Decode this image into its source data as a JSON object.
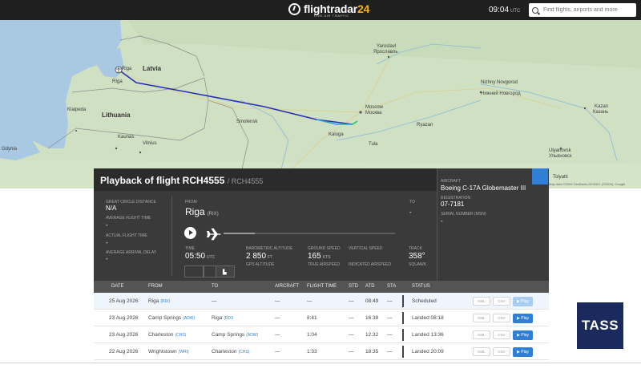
{
  "header": {
    "logo_main": "flightradar",
    "logo_num": "24",
    "logo_sub": "LIVE AIR TRAFFIC",
    "time": "09:04",
    "time_unit": "UTC",
    "search_placeholder": "Find flights, airports and more"
  },
  "map": {
    "labels": {
      "latvia": "Latvia",
      "lithuania": "Lithuania",
      "riga": "Riga",
      "riga_cyr": "Rīga",
      "moscow": "Moscow",
      "moscow_cyr": "Москва",
      "yaroslavl": "Yaroslavl",
      "yaroslavl_cyr": "Ярославль",
      "nizhny": "Nizhny Novgorod",
      "nizhny_cyr": "Нижний Новгород",
      "kazan": "Kazan",
      "kazan_cyr": "Казань",
      "klaipeda": "Klaipeda",
      "kaunas": "Kaunas",
      "vilnius": "Vilnius",
      "gdynia": "Gdynia",
      "ulyanovsk": "Ulyanovsk",
      "ulyanovsk_cyr": "Ульяновск",
      "tolyatti": "Tolyatti",
      "smolensk": "Smolensk",
      "kaluga": "Kaluga",
      "tula": "Tula",
      "ryazan": "Ryazan"
    },
    "attribution": "Map data ©2026 GeoBasis-DE/BKG (©2009), Google"
  },
  "flight": {
    "title": "Playback of flight RCH4555",
    "subtitle": "/ RCH4555",
    "great_circle_label": "GREAT CIRCLE DISTANCE",
    "great_circle_value": "N/A",
    "avg_flight_time_label": "AVERAGE FLIGHT TIME",
    "avg_flight_time_value": "-",
    "actual_flight_time_label": "ACTUAL FLIGHT TIME",
    "actual_flight_time_value": "-",
    "avg_arrival_delay_label": "AVERAGE ARRIVAL DELAY",
    "avg_arrival_delay_value": "-",
    "from_label": "FROM",
    "from_city": "Riga",
    "from_code": "(RIX)",
    "to_label": "TO",
    "to_value": "-",
    "progress": 0.18,
    "time_label": "TIME",
    "time_value": "05:50",
    "time_unit": "UTC",
    "baro_alt_label": "BAROMETRIC ALTITUDE",
    "baro_alt_value": "2 850",
    "baro_alt_unit": "FT",
    "gps_alt_label": "GPS ALTITUDE",
    "ground_speed_label": "GROUND SPEED",
    "ground_speed_value": "165",
    "ground_speed_unit": "KTS",
    "true_airspeed_label": "TRUE AIRSPEED",
    "vertical_speed_label": "VERTICAL SPEED",
    "indicated_airspeed_label": "INDICATED AIRSPEED",
    "track_label": "TRACK",
    "track_value": "358°",
    "squawk_label": "SQUAWK",
    "aircraft_label": "AIRCRAFT",
    "aircraft_value": "Boeing C-17A Globemaster III",
    "registration_label": "REGISTRATION",
    "registration_value": "07-7181",
    "serial_label": "SERIAL NUMBER (MSN)",
    "serial_value": "-"
  },
  "table": {
    "headers": [
      "DATE",
      "FROM",
      "TO",
      "AIRCRAFT",
      "FLIGHT TIME",
      "STD",
      "ATD",
      "STA",
      "STATUS"
    ],
    "kml": "KML",
    "csv": "CSV",
    "play": "▶ Play",
    "rows": [
      {
        "date": "25 Aug 2026",
        "from": "Riga",
        "from_code": "(RIX)",
        "to": "—",
        "to_code": "",
        "aircraft": "—",
        "flight_time": "—",
        "std": "—",
        "atd": "08:49",
        "sta": "—",
        "status": "Scheduled"
      },
      {
        "date": "23 Aug 2026",
        "from": "Camp Springs",
        "from_code": "(ADW)",
        "to": "Riga",
        "to_code": "(RIX)",
        "aircraft": "—",
        "flight_time": "8:41",
        "std": "—",
        "atd": "16:38",
        "sta": "—",
        "status": "Landed 08:18"
      },
      {
        "date": "23 Aug 2026",
        "from": "Charleston",
        "from_code": "(CHS)",
        "to": "Camp Springs",
        "to_code": "(ADW)",
        "aircraft": "—",
        "flight_time": "1:04",
        "std": "—",
        "atd": "12:32",
        "sta": "—",
        "status": "Landed 13:36"
      },
      {
        "date": "22 Aug 2026",
        "from": "Wrightstown",
        "from_code": "(WRI)",
        "to": "Charleston",
        "to_code": "(CHS)",
        "aircraft": "—",
        "flight_time": "1:33",
        "std": "—",
        "atd": "18:35",
        "sta": "—",
        "status": "Landed 20:09"
      }
    ]
  },
  "badge": {
    "text": "TASS",
    "color": "#1b2a5c"
  },
  "colors": {
    "accent": "#2f7fd7",
    "logo_num": "#f7b500"
  }
}
